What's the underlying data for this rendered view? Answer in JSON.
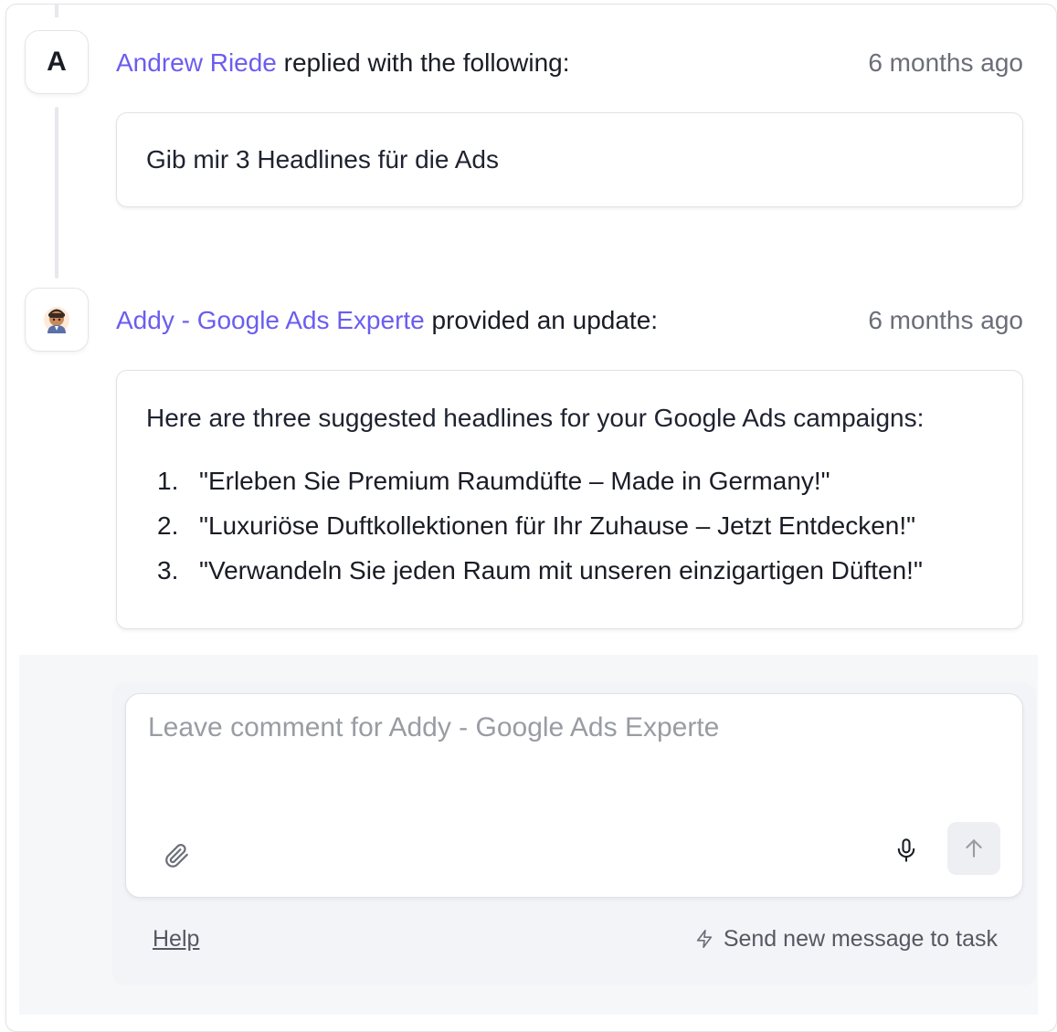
{
  "entries": [
    {
      "avatar_letter": "A",
      "author": "Andrew Riede",
      "action": "replied with the following:",
      "time": "6 months ago",
      "message": "Gib mir 3 Headlines für die Ads"
    },
    {
      "avatar_icon": "person-emoji-icon",
      "author": "Addy - Google Ads Experte",
      "action": "provided an update:",
      "time": "6 months ago",
      "intro": "Here are three suggested headlines for your Google Ads campaigns:",
      "items": [
        {
          "num": "1.",
          "text": "\"Erleben Sie Premium Raumdüfte – Made in Germany!\""
        },
        {
          "num": "2.",
          "text": "\"Luxuriöse Duftkollektionen für Ihr Zuhause – Jetzt Entdecken!\""
        },
        {
          "num": "3.",
          "text": "\"Verwandeln Sie jeden Raum mit unseren einzigartigen Düften!\""
        }
      ]
    }
  ],
  "composer": {
    "placeholder": "Leave comment for Addy - Google Ads Experte",
    "value": "",
    "attach_icon": "paperclip-icon",
    "mic_icon": "microphone-icon",
    "send_icon": "arrow-up-icon"
  },
  "footer": {
    "help_label": "Help",
    "send_hint_icon": "lightning-icon",
    "send_hint_label": "Send new message to task"
  },
  "colors": {
    "author": "#6a5df0",
    "text": "#1a1c25",
    "muted": "#6b6e78"
  }
}
